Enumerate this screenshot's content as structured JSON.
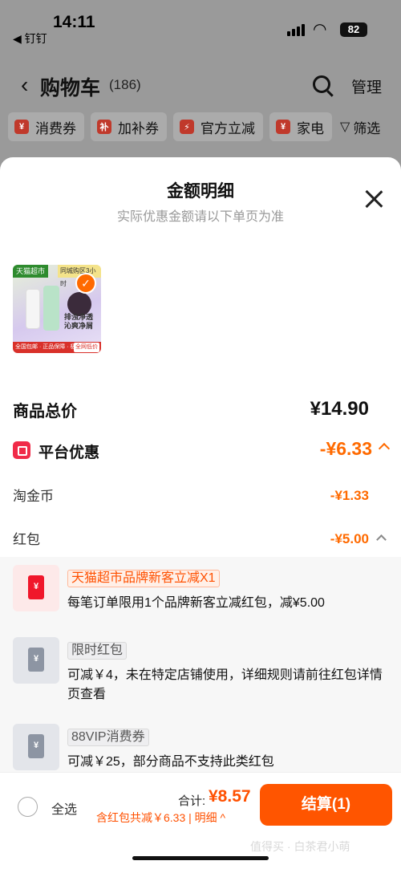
{
  "status_bar": {
    "time": "14:11",
    "back_app": "◀ 钉钉",
    "battery": "82"
  },
  "cart": {
    "title": "购物车",
    "count": "(186)",
    "manage_label": "管理",
    "chips": [
      {
        "icon": "¥",
        "label": "消费券"
      },
      {
        "icon": "补",
        "label": "加补券"
      },
      {
        "icon": "⚡",
        "label": "官方立减"
      },
      {
        "icon": "¥",
        "label": "家电"
      }
    ],
    "filter_label": "筛选"
  },
  "sheet": {
    "title": "金额明细",
    "subtitle": "实际优惠金额请以下单页为准",
    "product": {
      "tag": "天猫超市",
      "tag2": "同城购区3小时",
      "slogan": "排浊净透 沁爽净屑",
      "bottom_left": "全国包邮 · 正品保障 · 极速发货",
      "bottom_right": "全网低价"
    },
    "total_label": "商品总价",
    "total_value": "¥14.90",
    "platform_label": "平台优惠",
    "platform_value": "-¥6.33",
    "coin_label": "淘金币",
    "coin_value": "-¥1.33",
    "hongbao_label": "红包",
    "hongbao_value": "-¥5.00",
    "hongbao_items": [
      {
        "style": "red",
        "tag": "天猫超市品牌新客立减X1",
        "desc": "每笔订单限用1个品牌新客立减红包，减¥5.00"
      },
      {
        "style": "grey",
        "tag": "限时红包",
        "desc": "可减￥4，未在特定店铺使用，详细规则请前往红包详情页查看"
      },
      {
        "style": "grey",
        "tag": "88VIP消费券",
        "desc": "可减￥25，部分商品不支持此类红包"
      }
    ]
  },
  "bottom_bar": {
    "select_all": "全选",
    "sum_label": "合计:",
    "sum_value": "¥8.57",
    "discount_text": "含红包共减￥6.33 | 明细 ^",
    "checkout_label": "结算(1)",
    "watermark": "值得买 · 白茶君小萌"
  },
  "colors": {
    "accent": "#ff5500",
    "price_orange": "#ff6a00",
    "platform_red": "#f02a48"
  }
}
